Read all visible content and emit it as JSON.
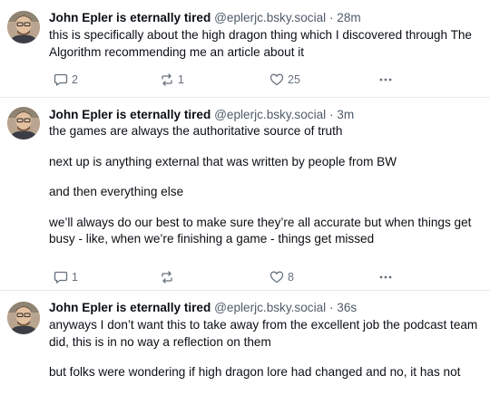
{
  "posts": [
    {
      "author": "John Epler is eternally tired",
      "handle": "@eplerjc.bsky.social",
      "separator": "·",
      "time": "28m",
      "paragraphs": [
        "this is specifically about the high dragon thing which I discovered through The Algorithm recommending me an article about it"
      ],
      "replies": "2",
      "reposts": "1",
      "likes": "25"
    },
    {
      "author": "John Epler is eternally tired",
      "handle": "@eplerjc.bsky.social",
      "separator": "·",
      "time": "3m",
      "paragraphs": [
        "the games are always the authoritative source of truth",
        "next up is anything external that was written by people from BW",
        "and then everything else",
        "we’ll always do our best to make sure they’re all accurate but when things get busy - like, when we’re finishing a game - things get missed"
      ],
      "replies": "1",
      "reposts": "",
      "likes": "8"
    },
    {
      "author": "John Epler is eternally tired",
      "handle": "@eplerjc.bsky.social",
      "separator": "·",
      "time": "36s",
      "paragraphs": [
        "anyways I don’t want this to take away from the excellent job the podcast team did, this is in no way a reflection on them",
        "but folks were wondering if high dragon lore had changed and no, it has not"
      ]
    }
  ],
  "icons": {
    "reply": "speech-bubble-icon",
    "repost": "repost-arrows-icon",
    "like": "heart-outline-icon",
    "more": "ellipsis-icon"
  },
  "colors": {
    "text": "#0b0f14",
    "muted": "#4f5b6a",
    "action": "#66707c",
    "divider": "#e6e9ee"
  }
}
